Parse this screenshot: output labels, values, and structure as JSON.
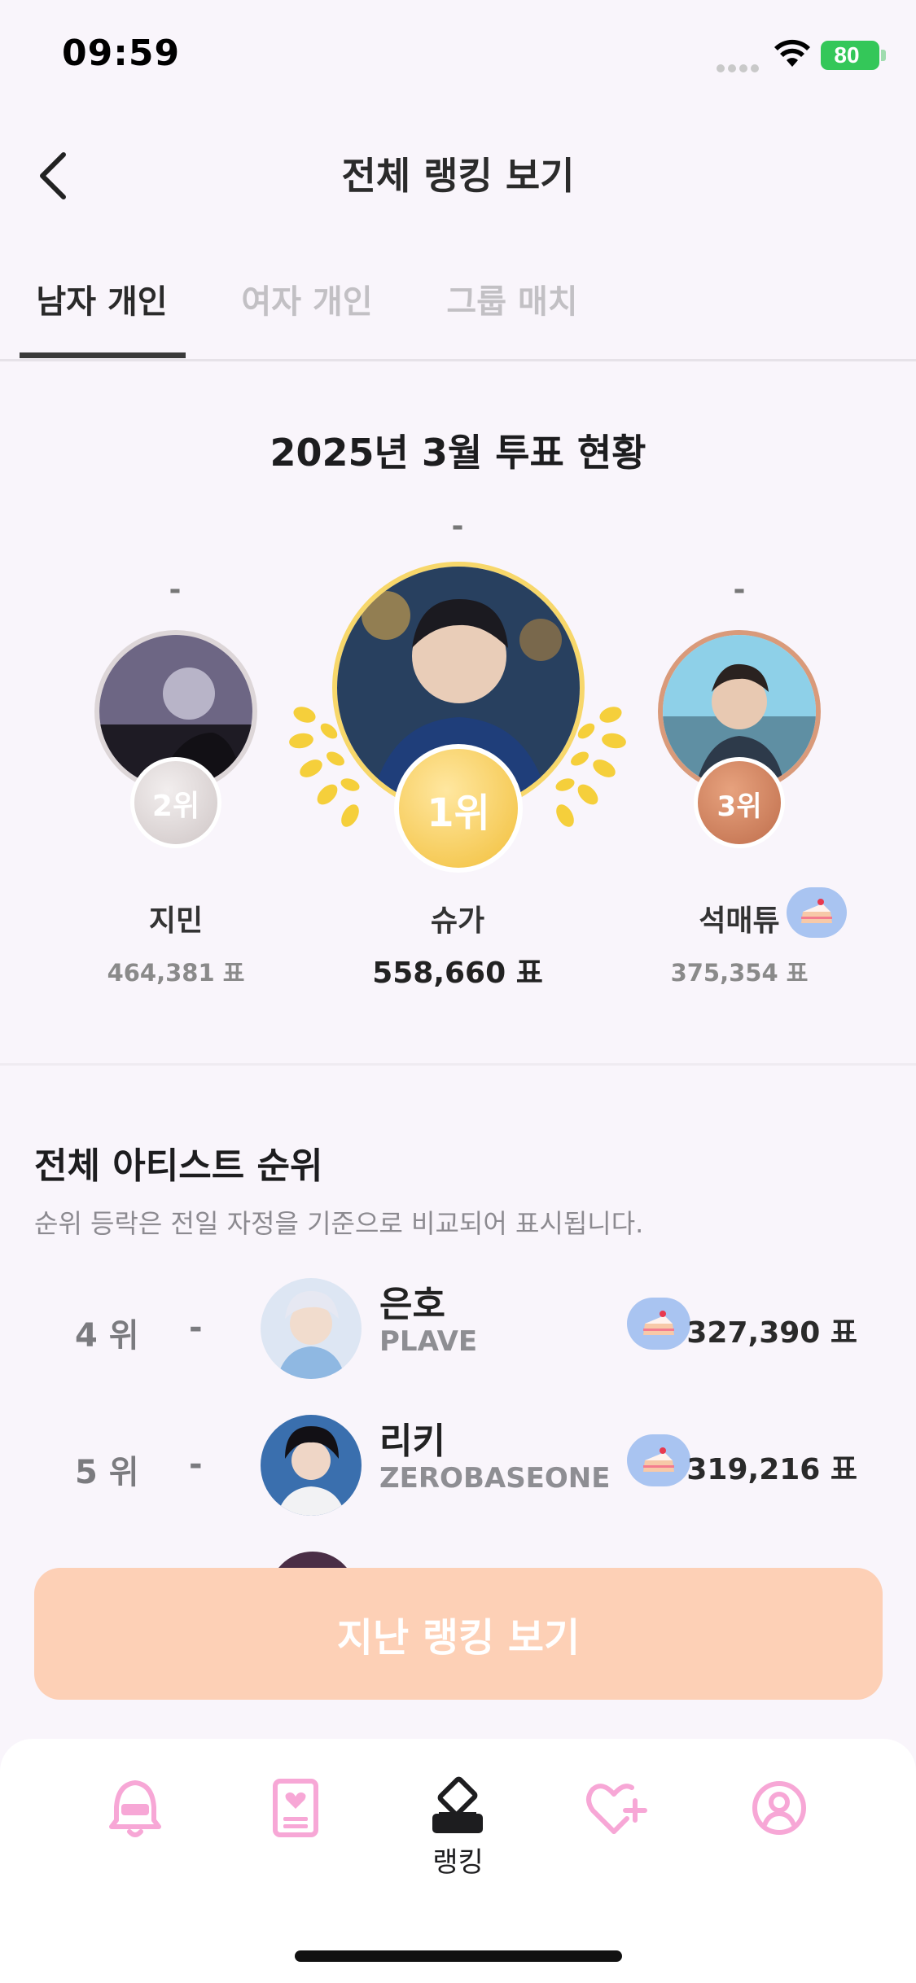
{
  "status_bar": {
    "time": "09:59",
    "battery": "80"
  },
  "header": {
    "title": "전체 랭킹 보기"
  },
  "tabs": [
    {
      "label": "남자 개인",
      "active": true
    },
    {
      "label": "여자 개인",
      "active": false
    },
    {
      "label": "그룹 매치",
      "active": false
    }
  ],
  "podium": {
    "title": "2025년 3월 투표 현황",
    "entries": [
      {
        "rank_label": "2위",
        "name": "지민",
        "votes": "464,381 표",
        "change": "-"
      },
      {
        "rank_label": "1위",
        "name": "슈가",
        "votes": "558,660 표",
        "change": "-"
      },
      {
        "rank_label": "3위",
        "name": "석매튜",
        "votes": "375,354 표",
        "change": "-"
      }
    ]
  },
  "ranking": {
    "title": "전체 아티스트 순위",
    "description": "순위 등락은 전일 자정을 기준으로 비교되어 표시됩니다.",
    "rows": [
      {
        "rank": "4 위",
        "change": "-",
        "name": "은호",
        "group": "PLAVE",
        "votes": "327,390 표"
      },
      {
        "rank": "5 위",
        "change": "-",
        "name": "리키",
        "group": "ZEROBASEONE",
        "votes": "319,216 표"
      }
    ]
  },
  "history_button": {
    "label": "지난 랭킹 보기"
  },
  "tab_bar": {
    "items": [
      {
        "icon": "bell-icon"
      },
      {
        "icon": "photocard-icon"
      },
      {
        "icon": "vote-box-icon",
        "label": "랭킹",
        "active": true
      },
      {
        "icon": "heart-plus-icon"
      },
      {
        "icon": "profile-icon"
      }
    ]
  },
  "colors": {
    "accent_pink": "#f7a7d6",
    "button_peach": "#fdd0b6",
    "gold": "#f5c644",
    "silver": "#d6cdcd",
    "bronze": "#c97a5a"
  }
}
